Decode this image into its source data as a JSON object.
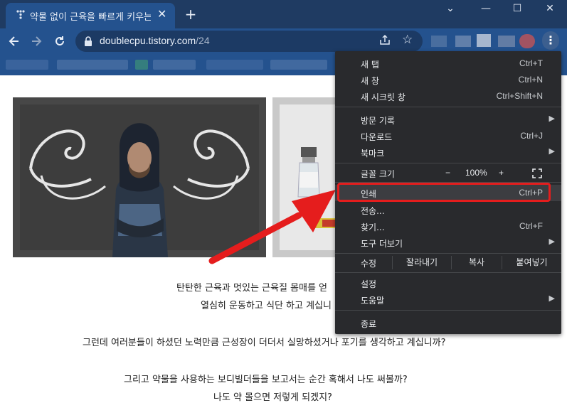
{
  "window": {
    "tab_title": "약물 없이 근육을 빠르게 키우는",
    "new_tab_symbol": "+",
    "tab_close_symbol": "✕",
    "minimize": "—",
    "maximize": "☐",
    "close": "✕"
  },
  "toolbar": {
    "url_host": "doublecpu.tistory.com",
    "url_path": "/24"
  },
  "article": {
    "lines": [
      "탄탄한 근육과 멋있는 근육질 몸매를 얻",
      "열심히 운동하고 식단 하고 계십니",
      "그런데 여러분들이 하셨던 노력만큼 근성장이 더더서 실망하셨거나 포기를 생각하고 계십니까?",
      "그리고 약물을 사용하는 보디빌더들을 보고서는 순간 혹해서 나도 써볼까?",
      "나도 약 몰으면 저렇게 되겠지?"
    ]
  },
  "menu": {
    "new_tab": {
      "label": "새 탭",
      "shortcut": "Ctrl+T"
    },
    "new_window": {
      "label": "새 창",
      "shortcut": "Ctrl+N"
    },
    "incognito": {
      "label": "새 시크릿 창",
      "shortcut": "Ctrl+Shift+N"
    },
    "history": {
      "label": "방문 기록"
    },
    "downloads": {
      "label": "다운로드",
      "shortcut": "Ctrl+J"
    },
    "bookmarks": {
      "label": "북마크"
    },
    "zoom": {
      "label": "글꼴 크기",
      "minus": "−",
      "value": "100%",
      "plus": "+"
    },
    "print": {
      "label": "인쇄",
      "shortcut": "Ctrl+P"
    },
    "cast": {
      "label": "전송..."
    },
    "find": {
      "label": "찾기...",
      "shortcut": "Ctrl+F"
    },
    "more_tools": {
      "label": "도구 더보기"
    },
    "edit": {
      "label": "수정",
      "cut": "잘라내기",
      "copy": "복사",
      "paste": "붙여넣기"
    },
    "settings": {
      "label": "설정"
    },
    "help": {
      "label": "도움말"
    },
    "exit": {
      "label": "종료"
    },
    "submenu_arrow": "▶"
  },
  "colors": {
    "frame": "#1f3b62",
    "toolbar": "#24528e",
    "menu_bg": "#292a2d",
    "highlight": "#e51d1d"
  }
}
